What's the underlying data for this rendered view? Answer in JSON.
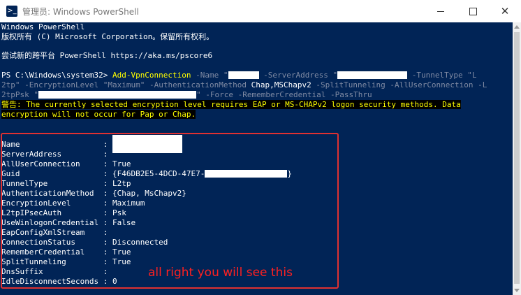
{
  "window": {
    "title": "管理员: Windows PowerShell",
    "app_icon": "powershell-icon",
    "close_glyph": "✕"
  },
  "console": {
    "header_line1": "Windows PowerShell",
    "header_line2": "版权所有 (C) Microsoft Corporation。保留所有权利。",
    "try_line": "尝试新的跨平台 PowerShell https://aka.ms/pscore6",
    "prompt": "PS C:\\Windows\\system32> ",
    "cmd_name": "Add-VpnConnection",
    "param_name": " -Name ",
    "param_server": " -ServerAddress ",
    "param_tunnel": " -TunnelType ",
    "val_tunnel_tail": "\"L",
    "val_tunnel_head": "2tp\"",
    "param_enc": " -EncryptionLevel ",
    "val_enc": "\"Maximum\"",
    "param_auth": " -AuthenticationMethod ",
    "val_auth": "Chap,MSChapv2",
    "param_split": " -SplitTunneling -AllUserConnection -L",
    "param_psk_head": "2tpPsk ",
    "param_force": " -Force -RememberCredential -PassThru",
    "warning_line1": "警告: The currently selected encryption level requires EAP or MS-CHAPv2 logon security methods. Data",
    "warning_line2": "encryption will not occur for Pap or Chap."
  },
  "properties": [
    {
      "key": "Name                  : ",
      "value": ""
    },
    {
      "key": "ServerAddress         : ",
      "value": ""
    },
    {
      "key": "AllUserConnection     : ",
      "value": "True"
    },
    {
      "key": "Guid                  : ",
      "value": "{F46DB2E5-4DCD-47E7-",
      "value_tail": "}"
    },
    {
      "key": "TunnelType            : ",
      "value": "L2tp"
    },
    {
      "key": "AuthenticationMethod  : ",
      "value": "{Chap, MsChapv2}"
    },
    {
      "key": "EncryptionLevel       : ",
      "value": "Maximum"
    },
    {
      "key": "L2tpIPsecAuth         : ",
      "value": "Psk"
    },
    {
      "key": "UseWinlogonCredential : ",
      "value": "False"
    },
    {
      "key": "EapConfigXmlStream    : ",
      "value": ""
    },
    {
      "key": "ConnectionStatus      : ",
      "value": "Disconnected"
    },
    {
      "key": "RememberCredential    : ",
      "value": "True"
    },
    {
      "key": "SplitTunneling        : ",
      "value": "True"
    },
    {
      "key": "DnsSuffix             : ",
      "value": ""
    },
    {
      "key": "IdleDisconnectSeconds : ",
      "value": "0"
    }
  ],
  "annotation": {
    "text": "all right you will see this",
    "color": "#ff2020"
  },
  "colors": {
    "console_bg": "#012456",
    "warning_fg": "#ffff00"
  }
}
